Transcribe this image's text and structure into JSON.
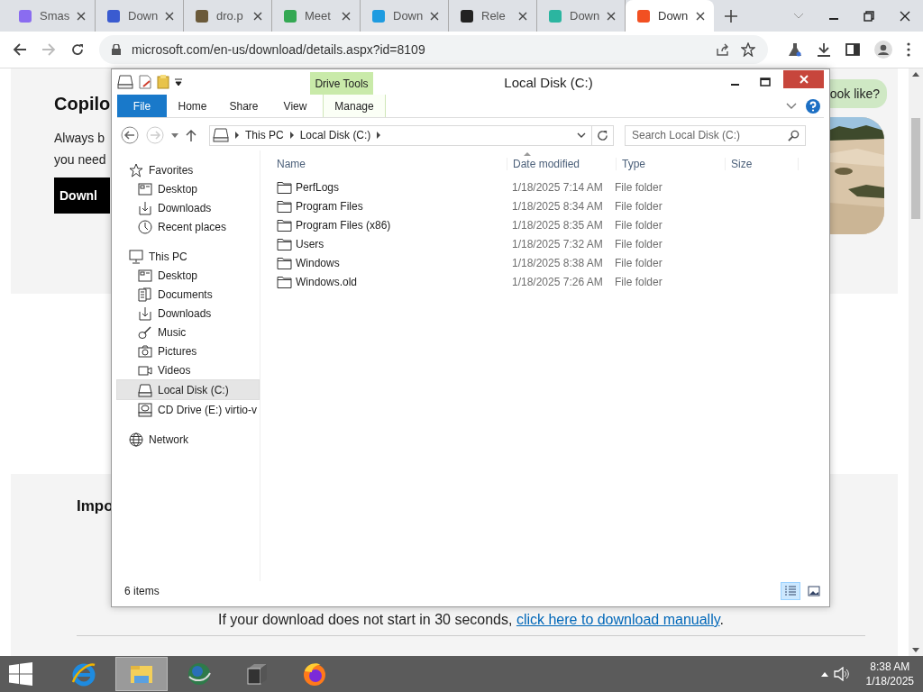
{
  "browser": {
    "tabs": [
      {
        "title": "Smas",
        "color": "#8a6cf0",
        "selected": false
      },
      {
        "title": "Down",
        "color": "#3a5bd0",
        "selected": false
      },
      {
        "title": "dro.p",
        "color": "#6b5a3a",
        "selected": false
      },
      {
        "title": "Meet",
        "color": "#34a853",
        "selected": false
      },
      {
        "title": "Down",
        "color": "#1e9be0",
        "selected": false
      },
      {
        "title": "Rele",
        "color": "#222222",
        "selected": false
      },
      {
        "title": "Down",
        "color": "#2bb5a0",
        "selected": false
      },
      {
        "title": "Down",
        "color": "#f25022",
        "selected": true
      }
    ],
    "url": "microsoft.com/en-us/download/details.aspx?id=8109"
  },
  "page": {
    "heading": "Copilo",
    "lines": [
      "Always b",
      "you need"
    ],
    "button": "Downl",
    "bubble": "ook like?",
    "section_heading": "Impo",
    "note": "If your download does not start in 30 seconds,",
    "note_link": "click here to download manually",
    "note_end": "."
  },
  "explorer": {
    "title": "Local Disk (C:)",
    "context_header": "Drive Tools",
    "ribbon_tabs": [
      {
        "label": "File",
        "kind": "file"
      },
      {
        "label": "Home",
        "kind": "tab"
      },
      {
        "label": "Share",
        "kind": "tab"
      },
      {
        "label": "View",
        "kind": "tab"
      },
      {
        "label": "Manage",
        "kind": "context"
      }
    ],
    "breadcrumb": [
      "This PC",
      "Local Disk (C:)"
    ],
    "search": {
      "placeholder": "Search Local Disk (C:)"
    },
    "nav": [
      {
        "label": "Favorites",
        "kind": "star",
        "selected": false,
        "children": [
          {
            "label": "Desktop",
            "kind": "desktop",
            "selected": false
          },
          {
            "label": "Downloads",
            "kind": "download",
            "selected": false
          },
          {
            "label": "Recent places",
            "kind": "clock",
            "selected": false
          }
        ]
      },
      {
        "label": "This PC",
        "kind": "pc",
        "selected": false,
        "children": [
          {
            "label": "Desktop",
            "kind": "desktop",
            "selected": false
          },
          {
            "label": "Documents",
            "kind": "docs",
            "selected": false
          },
          {
            "label": "Downloads",
            "kind": "download",
            "selected": false
          },
          {
            "label": "Music",
            "kind": "music",
            "selected": false
          },
          {
            "label": "Pictures",
            "kind": "camera",
            "selected": false
          },
          {
            "label": "Videos",
            "kind": "video",
            "selected": false
          },
          {
            "label": "Local Disk (C:)",
            "kind": "drive",
            "selected": true
          },
          {
            "label": "CD Drive (E:) virtio-v",
            "kind": "cd",
            "selected": false
          }
        ]
      },
      {
        "label": "Network",
        "kind": "globe",
        "selected": false
      }
    ],
    "columns": [
      "Name",
      "Date modified",
      "Type",
      "Size"
    ],
    "rows": [
      {
        "name": "PerfLogs",
        "date": "1/18/2025 7:14 AM",
        "type": "File folder"
      },
      {
        "name": "Program Files",
        "date": "1/18/2025 8:34 AM",
        "type": "File folder"
      },
      {
        "name": "Program Files (x86)",
        "date": "1/18/2025 8:35 AM",
        "type": "File folder"
      },
      {
        "name": "Users",
        "date": "1/18/2025 7:32 AM",
        "type": "File folder"
      },
      {
        "name": "Windows",
        "date": "1/18/2025 8:38 AM",
        "type": "File folder"
      },
      {
        "name": "Windows.old",
        "date": "1/18/2025 7:26 AM",
        "type": "File folder"
      }
    ],
    "status": "6 items",
    "views": [
      {
        "kind": "details",
        "selected": true
      },
      {
        "kind": "thumbnails",
        "selected": false
      }
    ]
  },
  "taskbar": {
    "apps": [
      {
        "kind": "ie",
        "active": false
      },
      {
        "kind": "explorer",
        "active": true
      },
      {
        "kind": "globe",
        "active": false
      },
      {
        "kind": "archive",
        "active": false
      },
      {
        "kind": "firefox",
        "active": false
      }
    ],
    "time": "8:38 AM",
    "date": "1/18/2025"
  }
}
